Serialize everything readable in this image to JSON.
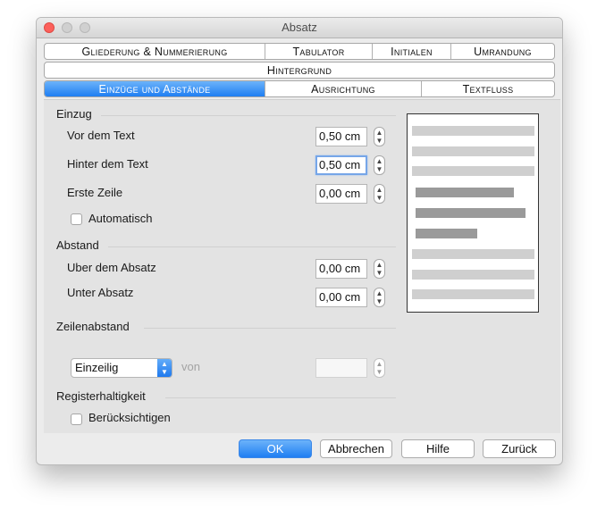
{
  "window": {
    "title": "Absatz"
  },
  "tabs_row1": [
    "Gliederung & Nummerierung",
    "Tabulator",
    "Initialen",
    "Umrandung"
  ],
  "tabs_row2": [
    "Hintergrund"
  ],
  "tabs_row3": [
    "Einzüge und Abstände",
    "Ausrichtung",
    "Textfluss"
  ],
  "active_tab": "Einzüge und Abstände",
  "einzug": {
    "heading": "Einzug",
    "vor_label": "Vor dem Text",
    "vor_value": "0,50 cm",
    "hinter_label": "Hinter dem Text",
    "hinter_value": "0,50 cm",
    "erste_label": "Erste Zeile",
    "erste_value": "0,00 cm",
    "auto_label": "Automatisch"
  },
  "abstand": {
    "heading": "Abstand",
    "ueber_label": "Uber dem Absatz",
    "ueber_value": "0,00 cm",
    "unter_label": "Unter Absatz",
    "unter_value": "0,00 cm"
  },
  "zeilenabstand": {
    "heading": "Zeilenabstand",
    "selected": "Einzeilig",
    "von_label": "von",
    "von_value": ""
  },
  "register": {
    "heading": "Registerhaltigkeit",
    "beruecksichtigen_label": "Berücksichtigen"
  },
  "buttons": {
    "ok": "OK",
    "abbrechen": "Abbrechen",
    "hilfe": "Hilfe",
    "zurueck": "Zurück"
  },
  "colors": {
    "accent": "#1f7ef2",
    "preview_light": "#cfcfcf",
    "preview_dark": "#9a9a9a"
  },
  "icons": {
    "stepper": "stepper-updown-icon",
    "select": "select-chevrons-icon"
  }
}
